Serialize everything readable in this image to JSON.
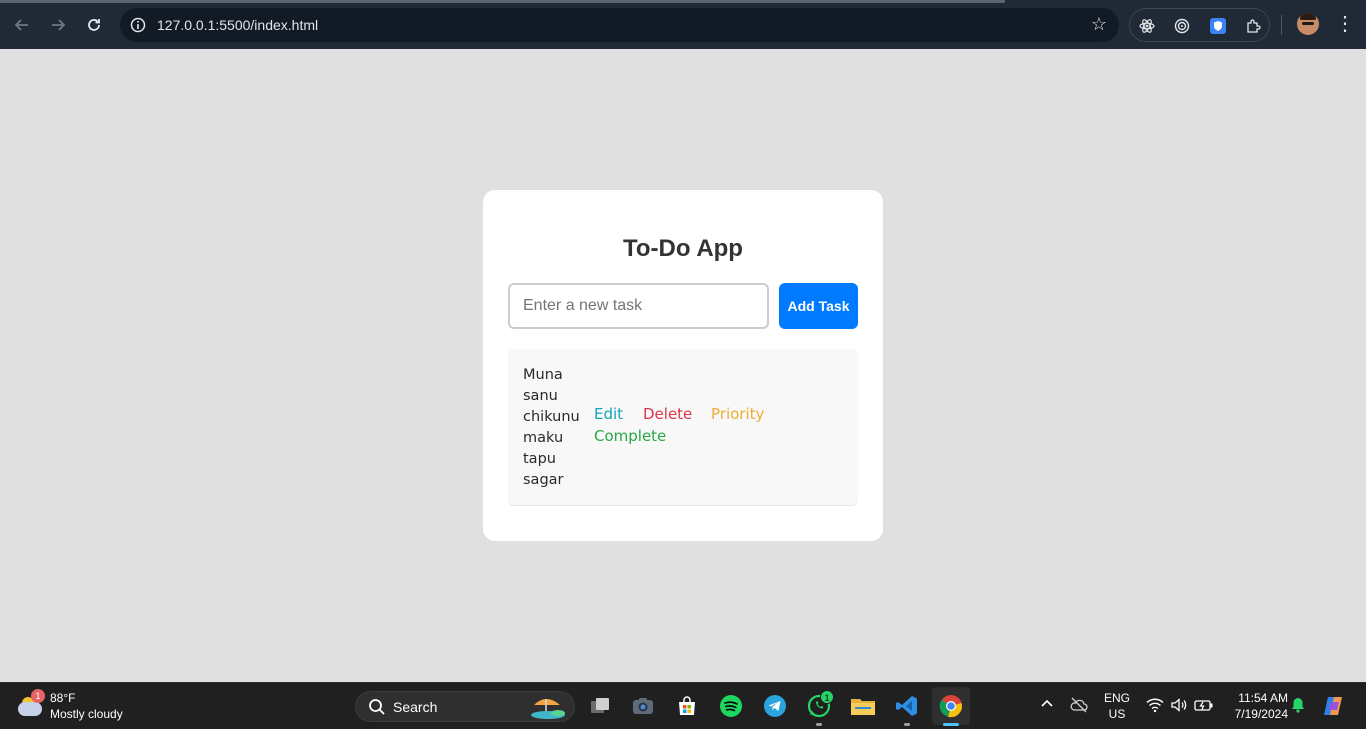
{
  "browser": {
    "url": "127.0.0.1:5500/index.html"
  },
  "app": {
    "title": "To-Do App",
    "input_placeholder": "Enter a new task",
    "input_value": "",
    "add_button_label": "Add Task",
    "tasks": [
      "Muna",
      "sanu",
      "chikunu",
      "maku",
      "tapu",
      "sagar"
    ],
    "actions": {
      "edit": "Edit",
      "delete": "Delete",
      "priority": "Priority",
      "complete": "Complete"
    }
  },
  "taskbar": {
    "weather": {
      "temp": "88°F",
      "description": "Mostly cloudy",
      "badge": "1"
    },
    "search_label": "Search",
    "whatsapp_badge": "1",
    "language": {
      "line1": "ENG",
      "line2": "US"
    },
    "time": "11:54 AM",
    "date": "7/19/2024"
  },
  "colors": {
    "primary": "#007bff",
    "edit": "#17a2b8",
    "delete": "#dc3545",
    "priority": "#f0ad33",
    "complete": "#28a745"
  }
}
